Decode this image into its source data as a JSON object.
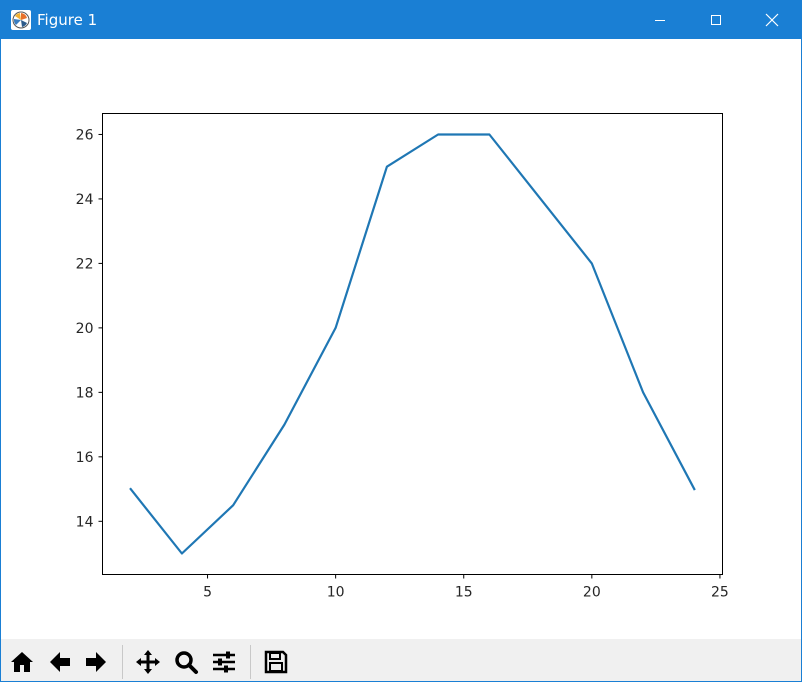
{
  "window": {
    "title": "Figure 1",
    "icons": {
      "app": "matplotlib-icon",
      "minimize": "minimize-icon",
      "maximize": "maximize-icon",
      "close": "close-icon"
    }
  },
  "toolbar": {
    "buttons": [
      {
        "name": "home-button",
        "icon": "home-icon"
      },
      {
        "name": "back-button",
        "icon": "arrow-left-icon"
      },
      {
        "name": "forward-button",
        "icon": "arrow-right-icon"
      },
      {
        "name": "pan-button",
        "icon": "move-icon"
      },
      {
        "name": "zoom-button",
        "icon": "search-icon"
      },
      {
        "name": "configure-subplots-button",
        "icon": "sliders-icon"
      },
      {
        "name": "save-button",
        "icon": "save-icon"
      }
    ]
  },
  "chart_data": {
    "type": "line",
    "title": "",
    "xlabel": "",
    "ylabel": "",
    "x": [
      2,
      4,
      6,
      8,
      10,
      12,
      14,
      16,
      18,
      20,
      22,
      24
    ],
    "series": [
      {
        "values": [
          15,
          13,
          14.5,
          17,
          20,
          25,
          26,
          26,
          24,
          22,
          18,
          15
        ],
        "color": "#1f77b4"
      }
    ],
    "xlim": [
      0.9,
      25.1
    ],
    "ylim": [
      12.35,
      26.65
    ],
    "xticks": [
      5,
      10,
      15,
      20,
      25
    ],
    "yticks": [
      14,
      16,
      18,
      20,
      22,
      24,
      26
    ],
    "grid": false,
    "legend": "none"
  }
}
